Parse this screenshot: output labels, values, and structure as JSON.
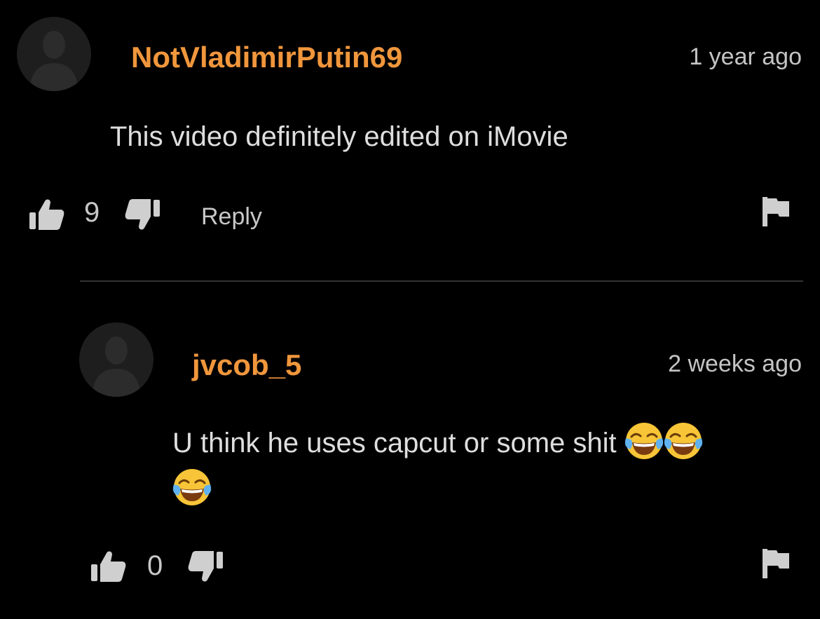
{
  "comments": [
    {
      "username": "NotVladimirPutin69",
      "timestamp": "1 year ago",
      "text": "This video definitely edited on iMovie",
      "likes": "9",
      "reply_label": "Reply"
    },
    {
      "username": "jvcob_5",
      "timestamp": "2 weeks ago",
      "text_line1": "U think he uses capcut or some shit",
      "emoji_count": 3,
      "likes": "0"
    }
  ],
  "icons": {
    "avatar": "default-avatar-icon",
    "like": "thumbs-up-icon",
    "dislike": "thumbs-down-icon",
    "report": "flag-icon",
    "emoji": "face-with-tears-of-joy"
  },
  "colors": {
    "background": "#000000",
    "username": "#f0963c",
    "divider": "#333333",
    "avatar": "#1e1e1e"
  }
}
